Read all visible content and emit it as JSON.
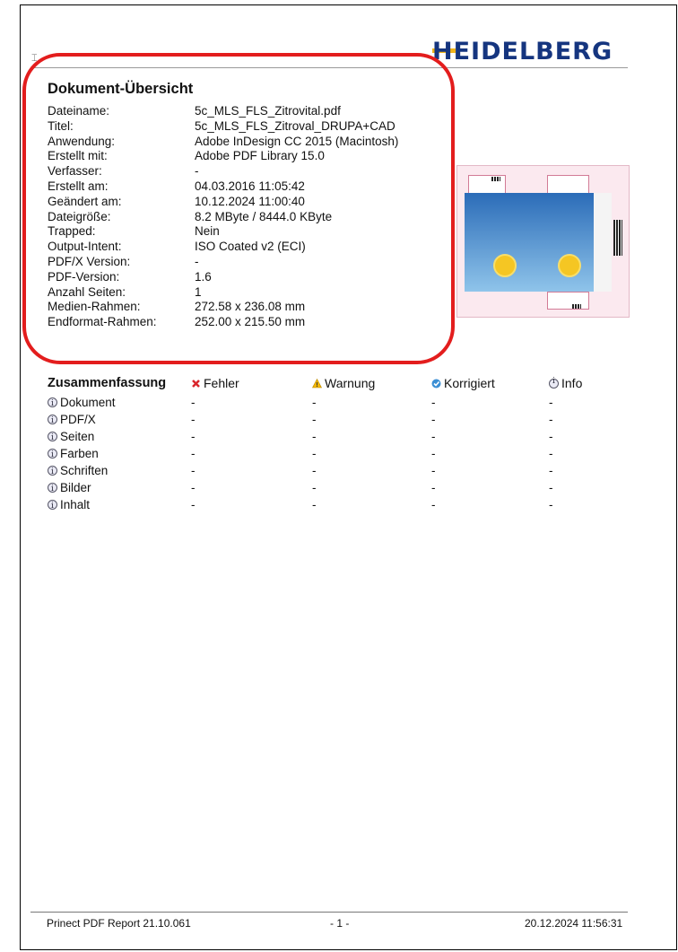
{
  "logo": {
    "text": "HEIDELBERG"
  },
  "overview": {
    "title": "Dokument-Übersicht",
    "rows": [
      {
        "label": "Dateiname:",
        "value": "5c_MLS_FLS_Zitrovital.pdf"
      },
      {
        "label": "Titel:",
        "value": "5c_MLS_FLS_Zitroval_DRUPA+CAD"
      },
      {
        "label": "Anwendung:",
        "value": "Adobe InDesign CC 2015 (Macintosh)"
      },
      {
        "label": "Erstellt mit:",
        "value": "Adobe PDF Library 15.0"
      },
      {
        "label": "Verfasser:",
        "value": "-"
      },
      {
        "label": "Erstellt am:",
        "value": "04.03.2016 11:05:42"
      },
      {
        "label": "Geändert am:",
        "value": "10.12.2024 11:00:40"
      },
      {
        "label": "Dateigröße:",
        "value": "8.2 MByte / 8444.0 KByte"
      },
      {
        "label": "Trapped:",
        "value": "Nein"
      },
      {
        "label": "Output-Intent:",
        "value": "ISO Coated v2 (ECI)"
      },
      {
        "label": "PDF/X Version:",
        "value": "-"
      },
      {
        "label": "PDF-Version:",
        "value": "1.6"
      },
      {
        "label": "Anzahl Seiten:",
        "value": "1"
      },
      {
        "label": "Medien-Rahmen:",
        "value": "272.58 x 236.08 mm"
      },
      {
        "label": "Endformat-Rahmen:",
        "value": "252.00 x 215.50 mm"
      }
    ]
  },
  "summary": {
    "title": "Zusammenfassung",
    "columns": [
      {
        "label": "Fehler",
        "icon": "error-icon",
        "color": "#d9262c"
      },
      {
        "label": "Warnung",
        "icon": "warning-icon",
        "color": "#f2b705"
      },
      {
        "label": "Korrigiert",
        "icon": "corrected-icon",
        "color": "#3b8fd4"
      },
      {
        "label": "Info",
        "icon": "info-icon",
        "color": "#5a5a7a"
      }
    ],
    "rows": [
      {
        "name": "Dokument",
        "cells": [
          "-",
          "-",
          "-",
          "-"
        ]
      },
      {
        "name": "PDF/X",
        "cells": [
          "-",
          "-",
          "-",
          "-"
        ]
      },
      {
        "name": "Seiten",
        "cells": [
          "-",
          "-",
          "-",
          "-"
        ]
      },
      {
        "name": "Farben",
        "cells": [
          "-",
          "-",
          "-",
          "-"
        ]
      },
      {
        "name": "Schriften",
        "cells": [
          "-",
          "-",
          "-",
          "-"
        ]
      },
      {
        "name": "Bilder",
        "cells": [
          "-",
          "-",
          "-",
          "-"
        ]
      },
      {
        "name": "Inhalt",
        "cells": [
          "-",
          "-",
          "-",
          "-"
        ]
      }
    ]
  },
  "footer": {
    "left": "Prinect PDF Report 21.10.061",
    "center": "- 1 -",
    "right": "20.12.2024 11:56:31"
  },
  "colors": {
    "highlight": "#e31d1d",
    "logo_blue": "#15357f",
    "logo_accent": "#f0b41a"
  }
}
